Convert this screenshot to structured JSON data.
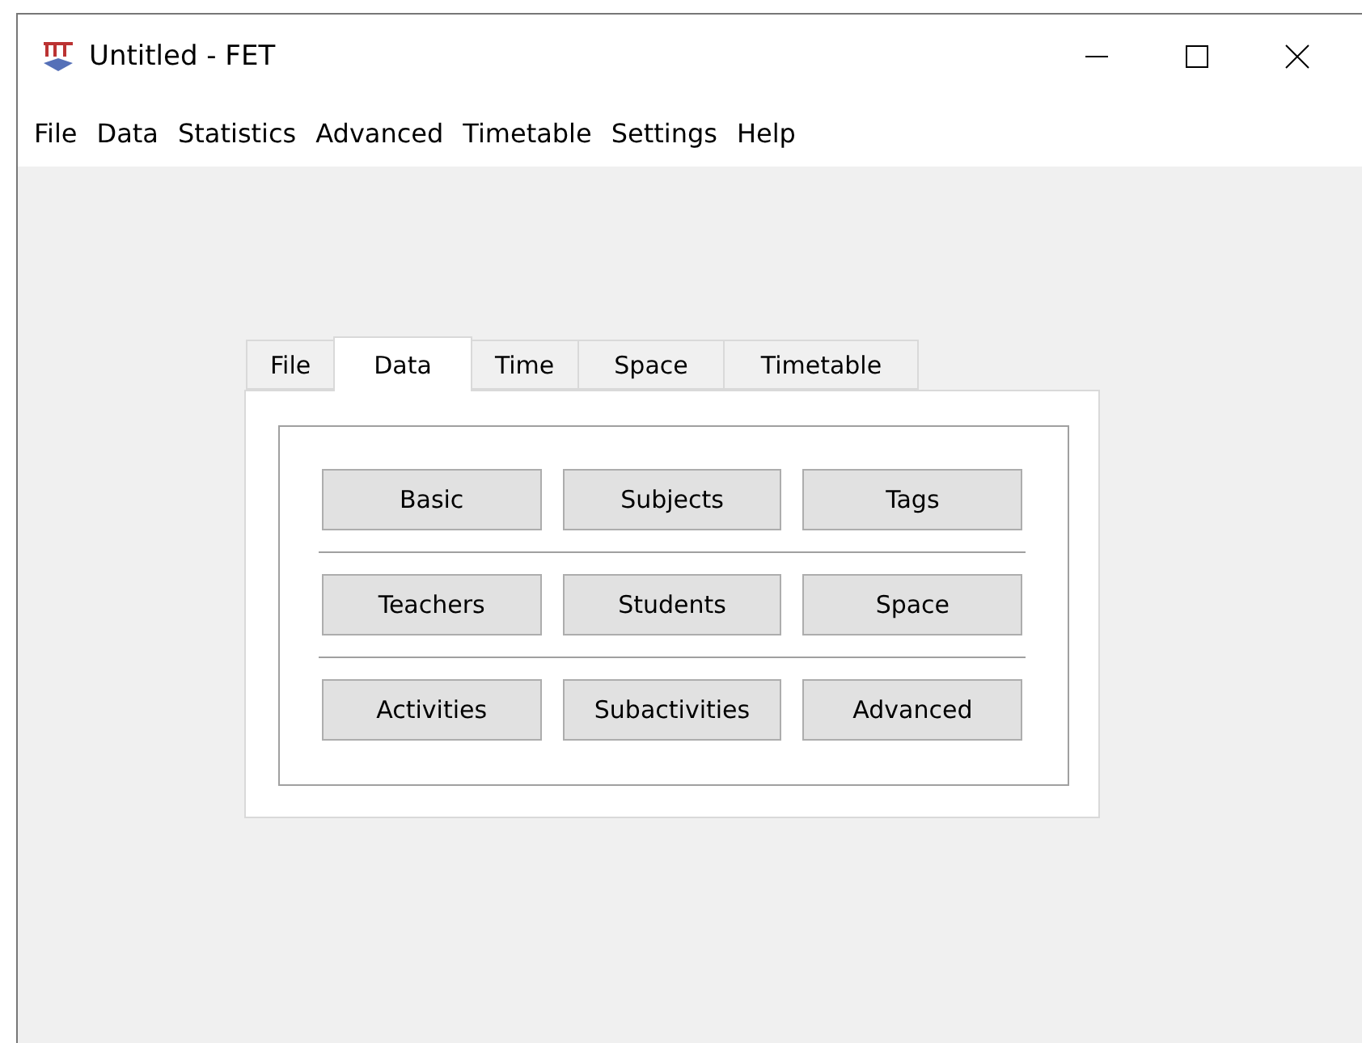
{
  "window": {
    "title": "Untitled - FET"
  },
  "menu": [
    "File",
    "Data",
    "Statistics",
    "Advanced",
    "Timetable",
    "Settings",
    "Help"
  ],
  "tabs": [
    {
      "label": "File",
      "selected": false
    },
    {
      "label": "Data",
      "selected": true
    },
    {
      "label": "Time",
      "selected": false
    },
    {
      "label": "Space",
      "selected": false
    },
    {
      "label": "Timetable",
      "selected": false
    }
  ],
  "button_rows": [
    [
      "Basic",
      "Subjects",
      "Tags"
    ],
    [
      "Teachers",
      "Students",
      "Space"
    ],
    [
      "Activities",
      "Subactivities",
      "Advanced"
    ]
  ]
}
